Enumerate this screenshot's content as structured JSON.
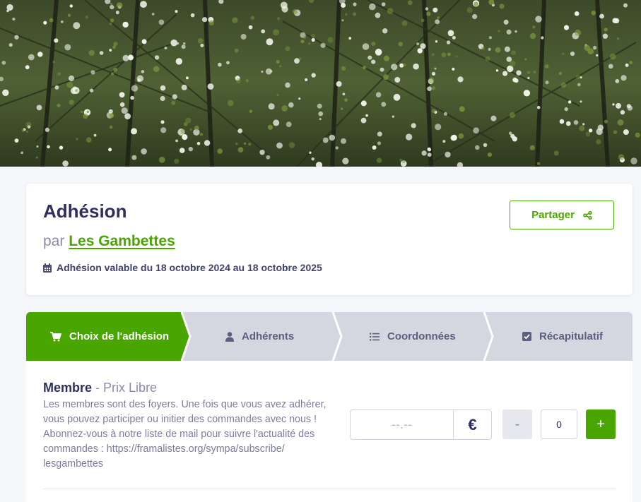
{
  "colors": {
    "accent": "#49a600",
    "text": "#2e2f5e",
    "muted": "#8a8bab",
    "step_inactive_bg": "#d4d7e0"
  },
  "banner": {
    "icon": "flowering-trees-photo"
  },
  "header": {
    "title": "Adhésion",
    "by_prefix": "par",
    "organization": "Les Gambettes",
    "validity_icon": "calendar-icon",
    "validity": "Adhésion valable du 18 octobre 2024 au 18 octobre 2025",
    "share_label": "Partager",
    "share_icon": "share-icon"
  },
  "steps": [
    {
      "label": "Choix de l'adhésion",
      "icon": "cart-icon",
      "active": true
    },
    {
      "label": "Adhérents",
      "icon": "user-icon",
      "active": false
    },
    {
      "label": "Coordonnées",
      "icon": "list-icon",
      "active": false
    },
    {
      "label": "Récapitulatif",
      "icon": "check-square-icon",
      "active": false
    }
  ],
  "tier": {
    "name": "Membre",
    "subtitle": "- Prix Libre",
    "description": "Les membres sont des foyers. Une fois que vous avez adhérer, vous pouvez participer ou initier des commandes avec nous ! Abonnez-vous à notre liste de mail pour suivre l'actualité des commandes : https://framalistes.org/sympa/subscribe/ lesgambettes",
    "price_placeholder": "--.--",
    "currency": "€",
    "minus_label": "-",
    "quantity": "0",
    "plus_label": "+"
  }
}
